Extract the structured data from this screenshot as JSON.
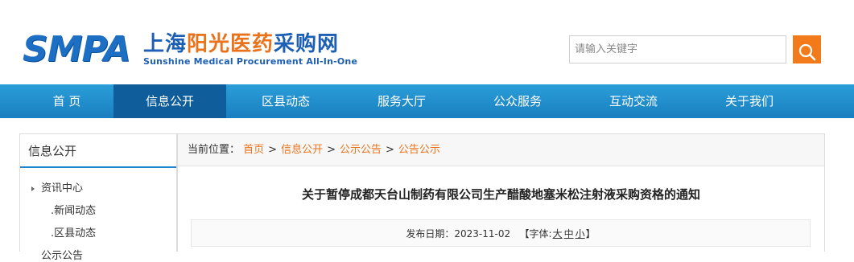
{
  "logo": {
    "abbr": "SMPA",
    "name_part1": "上海",
    "name_part2": "阳光医药",
    "name_part3": "采购网",
    "english": "Sunshine Medical Procurement All-In-One"
  },
  "search": {
    "placeholder": "请输入关键字",
    "icon": "search-icon"
  },
  "nav": {
    "items": [
      {
        "label": "首 页",
        "active": false
      },
      {
        "label": "信息公开",
        "active": true
      },
      {
        "label": "区县动态",
        "active": false
      },
      {
        "label": "服务大厅",
        "active": false
      },
      {
        "label": "公众服务",
        "active": false
      },
      {
        "label": "互动交流",
        "active": false
      },
      {
        "label": "关于我们",
        "active": false
      }
    ]
  },
  "sidebar": {
    "title": "信息公开",
    "items": [
      {
        "label": "资讯中心"
      },
      {
        "label": ".新闻动态"
      },
      {
        "label": ".区县动态"
      },
      {
        "label": "公示公告"
      }
    ]
  },
  "breadcrumb": {
    "prefix": "当前位置：",
    "items": [
      "首页",
      "信息公开",
      "公示公告",
      "公告公示"
    ],
    "separator": ">"
  },
  "article": {
    "title": "关于暂停成都天台山制药有限公司生产醋酸地塞米松注射液采购资格的通知",
    "date_label": "发布日期：",
    "date": "2023-11-02",
    "font_label": "【字体:",
    "font_large": "大",
    "font_medium": "中",
    "font_small": "小",
    "font_close": "】"
  },
  "colors": {
    "nav_bg": "#1f8dcc",
    "nav_active": "#0f5d9a",
    "accent_orange": "#e8731c",
    "brand_blue": "#1d6fc4"
  }
}
